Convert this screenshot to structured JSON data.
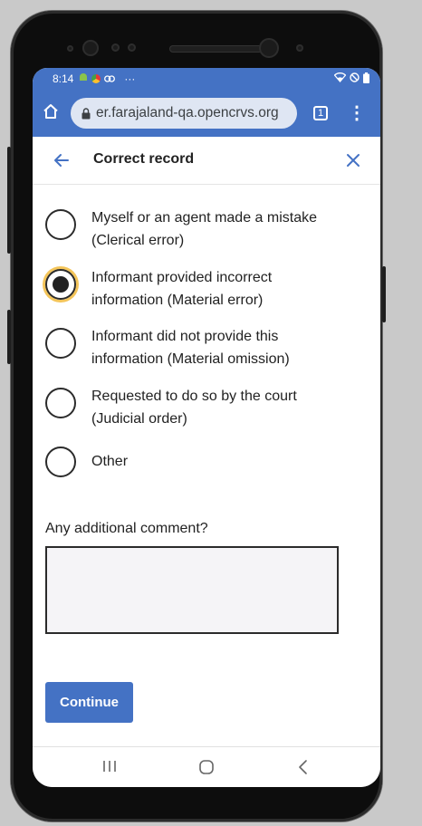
{
  "status_bar": {
    "time": "8:14",
    "overflow": "···",
    "icons": [
      "android-icon",
      "chrome-icon",
      "link-icon",
      "wifi-icon",
      "dnd-icon",
      "battery-icon"
    ]
  },
  "browser": {
    "url": "er.farajaland-qa.opencrvs.org",
    "tab_count": "1",
    "menu_glyph": "⋮"
  },
  "header": {
    "title": "Correct record"
  },
  "reasons": {
    "options": [
      {
        "label": "Myself or an agent made a mistake (Clerical error)",
        "selected": false
      },
      {
        "label": "Informant provided incorrect information (Material error)",
        "selected": true
      },
      {
        "label": "Informant did not provide this information (Material omission)",
        "selected": false
      },
      {
        "label": "Requested to do so by the court (Judicial order)",
        "selected": false
      },
      {
        "label": "Other",
        "selected": false
      }
    ]
  },
  "comment": {
    "label": "Any additional comment?",
    "value": ""
  },
  "actions": {
    "continue_label": "Continue"
  },
  "colors": {
    "brand": "#4472c4",
    "focus_ring": "#f4c55a",
    "text": "#222222"
  }
}
